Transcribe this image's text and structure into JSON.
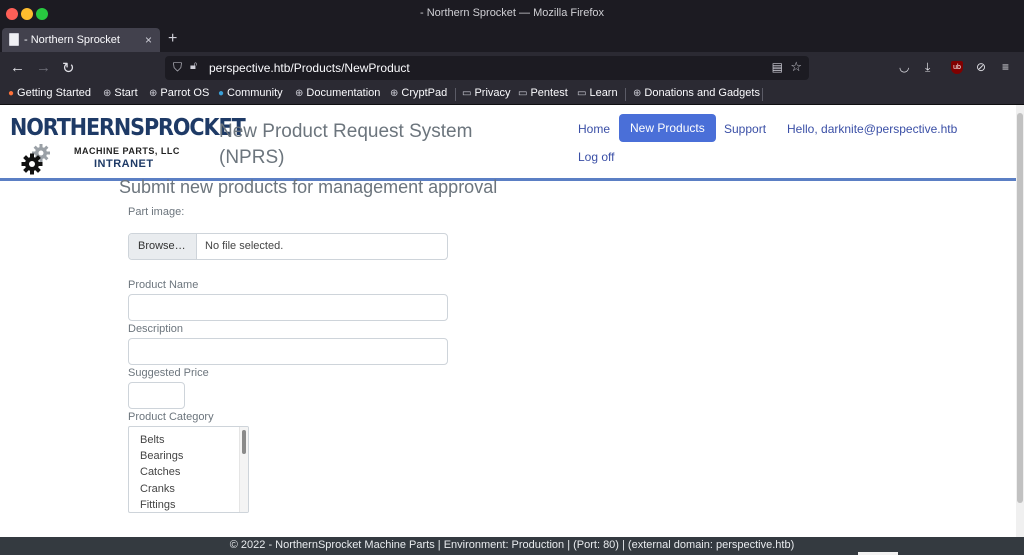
{
  "window": {
    "title": "- Northern Sprocket — Mozilla Firefox"
  },
  "tab": {
    "label": "- Northern Sprocket",
    "close": "×",
    "new": "+"
  },
  "nav": {
    "back": "←",
    "forward": "→",
    "reload": "↻",
    "url": "perspective.htb/Products/NewProduct"
  },
  "bookmarks": [
    "Getting Started",
    "Start",
    "Parrot OS",
    "Community",
    "Documentation",
    "CryptPad",
    "Privacy",
    "Pentest",
    "Learn",
    "Donations and Gadgets"
  ],
  "logo": {
    "line1": "NORTHERNSPROCKET",
    "line2": "MACHINE PARTS, LLC",
    "line3": "INTRANET"
  },
  "app_title": {
    "line1": "New Product Request System",
    "line2": "(NPRS)"
  },
  "menu": {
    "home": "Home",
    "new_products": "New Products",
    "support": "Support",
    "user": "Hello, darknite@perspective.htb",
    "logoff": "Log off"
  },
  "form": {
    "heading": "Submit new products for management approval",
    "part_image_label": "Part image:",
    "browse_label": "Browse…",
    "file_status": "No file selected.",
    "product_name_label": "Product Name",
    "description_label": "Description",
    "price_label": "Suggested Price",
    "category_label": "Product Category",
    "categories": [
      "Belts",
      "Bearings",
      "Catches",
      "Cranks",
      "Fittings"
    ]
  },
  "footer": "© 2022 - NorthernSprocket Machine Parts | Environment: Production | (Port: 80) | (external domain: perspective.htb)",
  "colors": {
    "accent": "#4a6fd8",
    "link": "#3a4fa6",
    "brand": "#1e3a66"
  }
}
